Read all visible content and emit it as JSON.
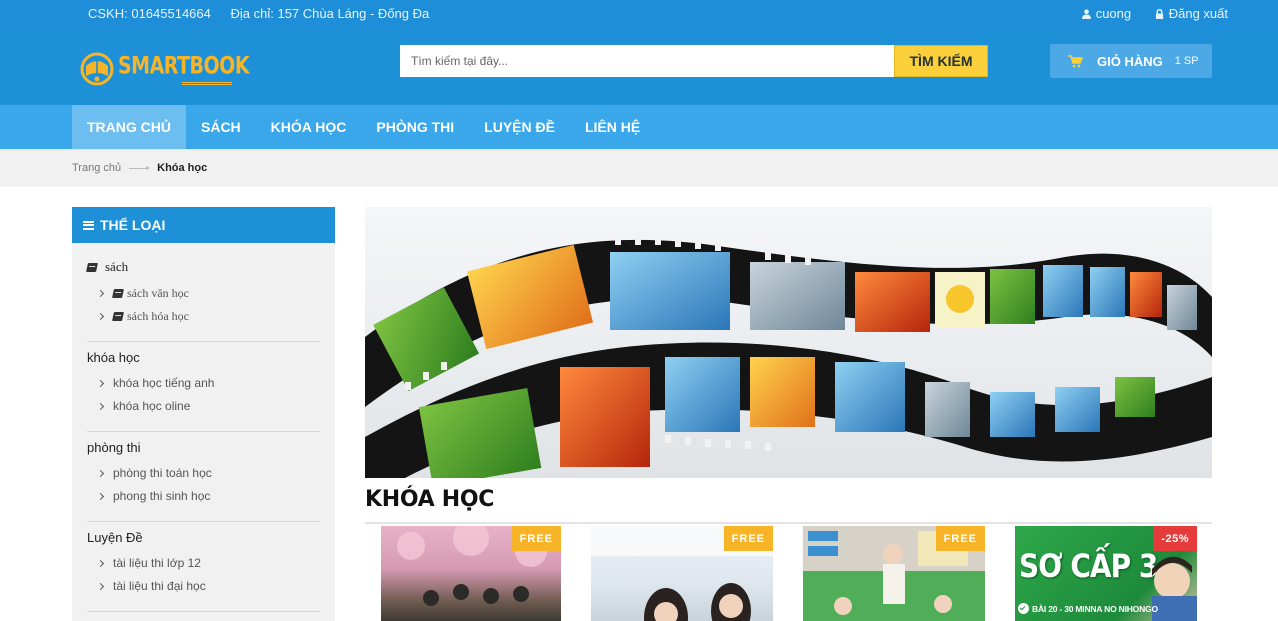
{
  "topbar": {
    "hotline": "CSKH: 01645514664",
    "address": "Địa chỉ: 157 Chùa Láng - Đống Đa",
    "username": "cuong",
    "logout": "Đăng xuất"
  },
  "header": {
    "logo_text": "SMARTBOOK",
    "search_placeholder": "Tìm kiếm tại đây...",
    "search_button": "TÌM KIẾM",
    "cart_label": "GIỎ HÀNG",
    "cart_count": "1 SP"
  },
  "nav": {
    "items": [
      "TRANG CHỦ",
      "SÁCH",
      "KHÓA HỌC",
      "PHÒNG THI",
      "LUYỆN ĐỀ",
      "LIÊN HỆ"
    ],
    "active": "TRANG CHỦ"
  },
  "breadcrumb": {
    "home": "Trang chủ",
    "current": "Khóa học"
  },
  "sidebar": {
    "heading": "THỂ LOẠI",
    "groups": [
      {
        "title": "sách",
        "items": [
          "sách văn học",
          "sách hóa học"
        ]
      },
      {
        "title": "khóa học",
        "items": [
          "khóa học tiếng anh",
          "khóa học oline"
        ]
      },
      {
        "title": "phòng thi",
        "items": [
          "phòng thi toán học",
          "phong thi sinh học"
        ]
      },
      {
        "title": "Luyện Đề",
        "items": [
          "tài liệu thi lớp 12",
          "tài liệu thi đại học"
        ]
      }
    ]
  },
  "main": {
    "section_title": "KHÓA HỌC",
    "products": [
      {
        "badge": "FREE"
      },
      {
        "badge": "FREE"
      },
      {
        "badge": "FREE"
      },
      {
        "badge": "-25%",
        "image_text": "SƠ CẤP 3",
        "image_caption": "BÀI 20 - 30 MINNA NO NIHONGO"
      }
    ]
  },
  "colors": {
    "primary": "#1e90d8",
    "nav": "#39a7ea",
    "accent": "#fbd03a",
    "free_badge": "#f7b426",
    "sale_badge": "#e63b3b"
  }
}
